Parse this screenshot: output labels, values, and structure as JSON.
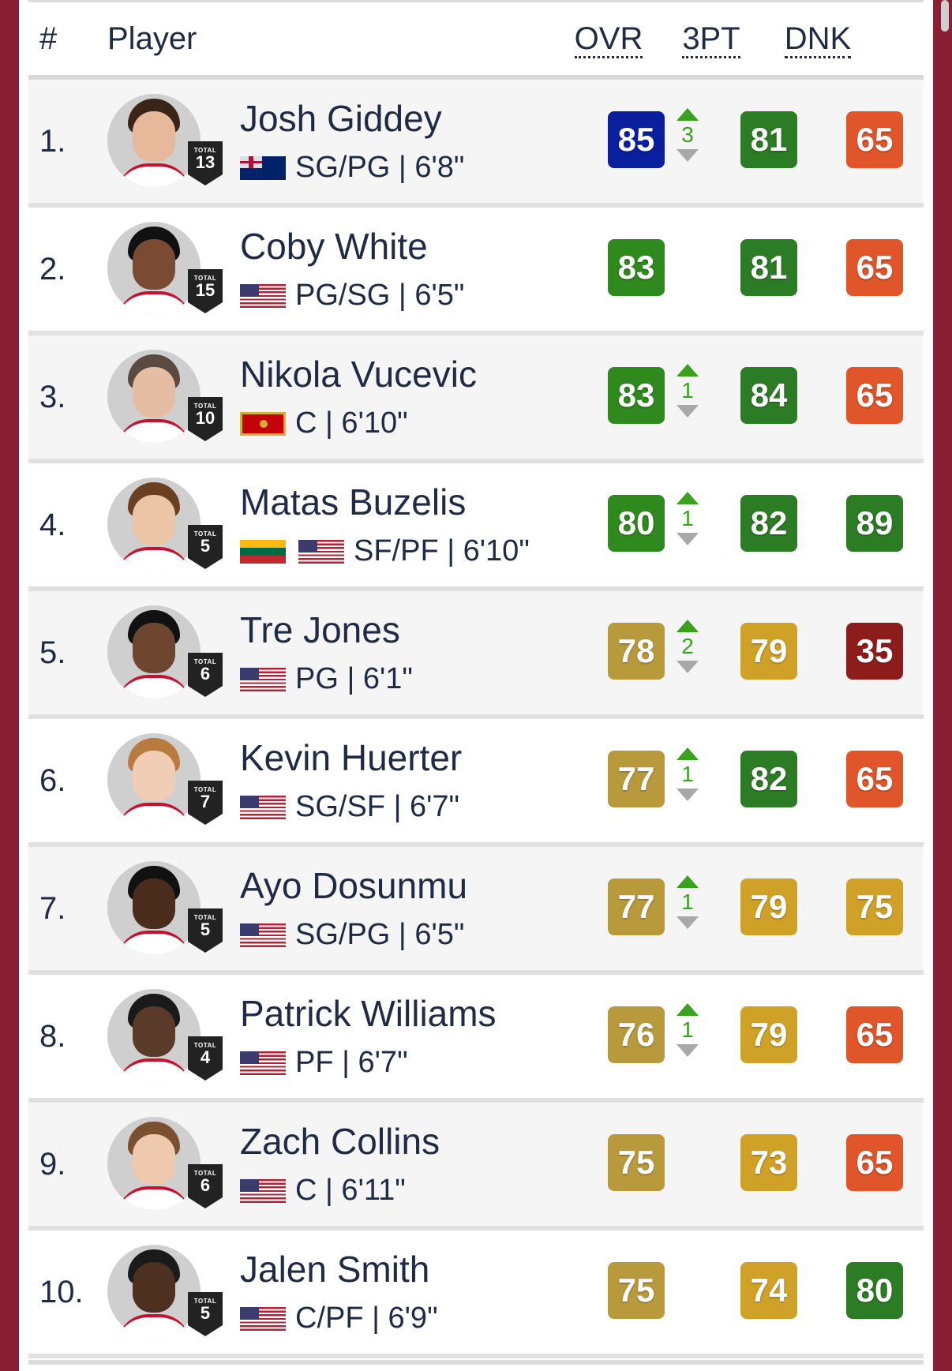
{
  "header": {
    "rank": "#",
    "player": "Player",
    "ovr": "OVR",
    "three_pt": "3PT",
    "dnk": "DNK"
  },
  "colors": {
    "blue": "#0a1f9e",
    "green": "#2f8a1e",
    "dark_green": "#2c7b25",
    "gold": "#b89a3c",
    "amber": "#cfa126",
    "orange": "#e0552a",
    "dark_red": "#8c1d1b"
  },
  "players": [
    {
      "rank": "1.",
      "name": "Josh Giddey",
      "flags": [
        "au"
      ],
      "details": "SG/PG | 6'8\"",
      "badge_label": "TOTAL",
      "badge_number": "13",
      "ovr": "85",
      "ovr_color": "#0a1f9e",
      "change": "3",
      "three_pt": "81",
      "three_pt_color": "#2c7b25",
      "dnk": "65",
      "dnk_color": "#e0552a",
      "hair": "#3a2418",
      "skin": "#e6b99a"
    },
    {
      "rank": "2.",
      "name": "Coby White",
      "flags": [
        "us"
      ],
      "details": "PG/SG | 6'5\"",
      "badge_label": "TOTAL",
      "badge_number": "15",
      "ovr": "83",
      "ovr_color": "#2f8a1e",
      "change": "",
      "three_pt": "81",
      "three_pt_color": "#2c7b25",
      "dnk": "65",
      "dnk_color": "#e0552a",
      "hair": "#111111",
      "skin": "#7a4b32"
    },
    {
      "rank": "3.",
      "name": "Nikola Vucevic",
      "flags": [
        "me"
      ],
      "details": "C | 6'10\"",
      "badge_label": "TOTAL",
      "badge_number": "10",
      "ovr": "83",
      "ovr_color": "#2f8a1e",
      "change": "1",
      "three_pt": "84",
      "three_pt_color": "#2c7b25",
      "dnk": "65",
      "dnk_color": "#e0552a",
      "hair": "#5a4a3f",
      "skin": "#e4bda3"
    },
    {
      "rank": "4.",
      "name": "Matas Buzelis",
      "flags": [
        "lt",
        "us"
      ],
      "details": "SF/PF | 6'10\"",
      "badge_label": "TOTAL",
      "badge_number": "5",
      "ovr": "80",
      "ovr_color": "#2f8a1e",
      "change": "1",
      "three_pt": "82",
      "three_pt_color": "#2c7b25",
      "dnk": "89",
      "dnk_color": "#2c7b25",
      "hair": "#6b3f22",
      "skin": "#ecc4a6"
    },
    {
      "rank": "5.",
      "name": "Tre Jones",
      "flags": [
        "us"
      ],
      "details": "PG | 6'1\"",
      "badge_label": "TOTAL",
      "badge_number": "6",
      "ovr": "78",
      "ovr_color": "#b89a3c",
      "change": "2",
      "three_pt": "79",
      "three_pt_color": "#cfa126",
      "dnk": "35",
      "dnk_color": "#8c1d1b",
      "hair": "#111111",
      "skin": "#6e4630"
    },
    {
      "rank": "6.",
      "name": "Kevin Huerter",
      "flags": [
        "us"
      ],
      "details": "SG/SF | 6'7\"",
      "badge_label": "TOTAL",
      "badge_number": "7",
      "ovr": "77",
      "ovr_color": "#b89a3c",
      "change": "1",
      "three_pt": "82",
      "three_pt_color": "#2c7b25",
      "dnk": "65",
      "dnk_color": "#e0552a",
      "hair": "#b87a3e",
      "skin": "#f0cdb4"
    },
    {
      "rank": "7.",
      "name": "Ayo Dosunmu",
      "flags": [
        "us"
      ],
      "details": "SG/PG | 6'5\"",
      "badge_label": "TOTAL",
      "badge_number": "5",
      "ovr": "77",
      "ovr_color": "#b89a3c",
      "change": "1",
      "three_pt": "79",
      "three_pt_color": "#cfa126",
      "dnk": "75",
      "dnk_color": "#cfa126",
      "hair": "#111111",
      "skin": "#4a2c1c"
    },
    {
      "rank": "8.",
      "name": "Patrick Williams",
      "flags": [
        "us"
      ],
      "details": "PF | 6'7\"",
      "badge_label": "TOTAL",
      "badge_number": "4",
      "ovr": "76",
      "ovr_color": "#b89a3c",
      "change": "1",
      "three_pt": "79",
      "three_pt_color": "#cfa126",
      "dnk": "65",
      "dnk_color": "#e0552a",
      "hair": "#1a1a1a",
      "skin": "#5a3a28"
    },
    {
      "rank": "9.",
      "name": "Zach Collins",
      "flags": [
        "us"
      ],
      "details": "C | 6'11\"",
      "badge_label": "TOTAL",
      "badge_number": "6",
      "ovr": "75",
      "ovr_color": "#b89a3c",
      "change": "",
      "three_pt": "73",
      "three_pt_color": "#cfa126",
      "dnk": "65",
      "dnk_color": "#e0552a",
      "hair": "#7a5030",
      "skin": "#efc9ae"
    },
    {
      "rank": "10.",
      "name": "Jalen Smith",
      "flags": [
        "us"
      ],
      "details": "C/PF | 6'9\"",
      "badge_label": "TOTAL",
      "badge_number": "5",
      "ovr": "75",
      "ovr_color": "#b89a3c",
      "change": "",
      "three_pt": "74",
      "three_pt_color": "#cfa126",
      "dnk": "80",
      "dnk_color": "#2c7b25",
      "hair": "#1a1a1a",
      "skin": "#4e3021"
    }
  ]
}
